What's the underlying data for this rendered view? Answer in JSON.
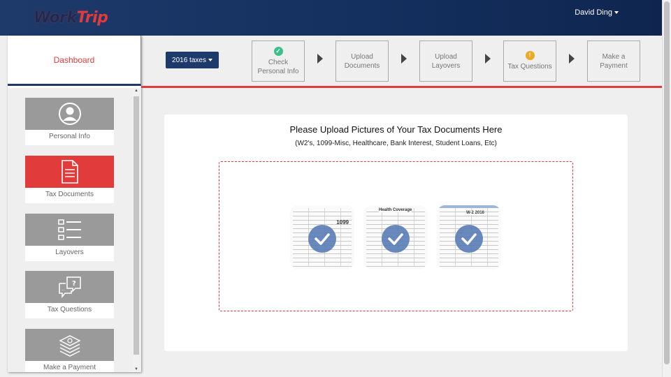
{
  "header": {
    "logo_part1": "Work",
    "logo_part2": "Trip",
    "user_name": "David Ding"
  },
  "sidebar": {
    "dashboard_label": "Dashboard",
    "items": [
      {
        "label": "Personal Info",
        "icon": "user-icon",
        "active": false
      },
      {
        "label": "Tax Documents",
        "icon": "document-icon",
        "active": true
      },
      {
        "label": "Layovers",
        "icon": "checklist-icon",
        "active": false
      },
      {
        "label": "Tax Questions",
        "icon": "chat-question-icon",
        "active": false
      },
      {
        "label": "Make a Payment",
        "icon": "money-stack-icon",
        "active": false
      }
    ]
  },
  "steps": {
    "year_button": "2016 taxes",
    "items": [
      {
        "line1": "Check",
        "line2": "Personal Info",
        "status": "complete",
        "badge": "✓",
        "badge_color": "#3cbf8a"
      },
      {
        "line1": "Upload",
        "line2": "Documents",
        "status": "none"
      },
      {
        "line1": "Upload",
        "line2": "Layovers",
        "status": "none"
      },
      {
        "line1": "Tax Questions",
        "line2": "",
        "status": "warning",
        "badge": "!",
        "badge_color": "#f0a81e"
      },
      {
        "line1": "Make a",
        "line2": "Payment",
        "status": "none"
      }
    ]
  },
  "upload": {
    "title": "Please Upload Pictures of Your Tax Documents Here",
    "subtitle": "(W2's, 1099-Misc, Healthcare, Bank Interest, Student Loans, Etc)",
    "docs": [
      {
        "name": "1099 form",
        "header": "1099"
      },
      {
        "name": "Health Coverage form",
        "header": "Health Coverage"
      },
      {
        "name": "W-2 form",
        "header": "W-2  2016"
      }
    ]
  },
  "colors": {
    "brand_navy": "#1e3a6b",
    "brand_red": "#e23b3b",
    "check_blue": "#5477b2"
  }
}
